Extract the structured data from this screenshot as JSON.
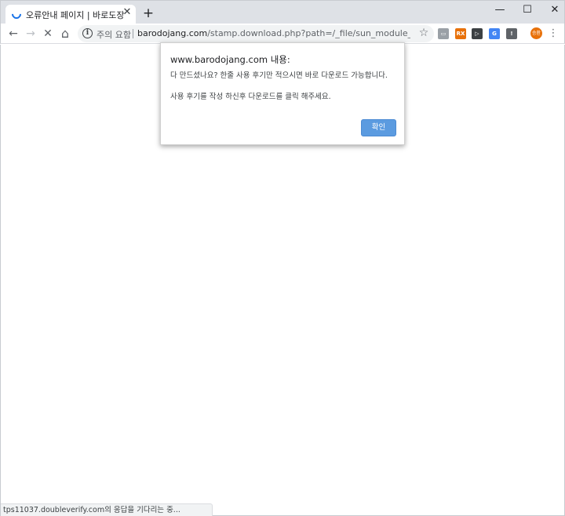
{
  "tab": {
    "title": "오류안내 페이지 | 바로도장",
    "close": "✕",
    "new_tab": "+"
  },
  "window": {
    "minimize": "—",
    "maximize": "☐",
    "close": "✕"
  },
  "toolbar": {
    "back": "←",
    "forward": "→",
    "stop": "✕",
    "home": "⌂",
    "security_label": "주의 요함",
    "url_host": "barodojang.com",
    "url_rest": "/stamp.download.php?path=/_file/sun_module_stamp&imag...",
    "star": "☆",
    "menu": "⋮"
  },
  "extensions": [
    {
      "name": "screen-capture-icon",
      "label": "▭",
      "color": "#9aa0a6"
    },
    {
      "name": "rss-extension-icon",
      "label": "RX",
      "color": "#e8710a"
    },
    {
      "name": "tag-extension-icon",
      "label": "▷",
      "color": "#3c4043"
    },
    {
      "name": "translate-icon",
      "label": "G",
      "color": "#4285f4"
    },
    {
      "name": "alert-extension-icon",
      "label": "!",
      "color": "#5f6368"
    }
  ],
  "profile": {
    "initials": "승환"
  },
  "dialog": {
    "title": "www.barodojang.com 내용:",
    "line1": "다 만드셨나요? 한줄 사용 후기만 적으시면 바로 다운로드 가능합니다.",
    "line2": "사용 후기를 작성 하신후 다운로드를 클릭 해주세요.",
    "ok_label": "확인",
    "ok_color": "#5b9be0"
  },
  "status_bar": {
    "text": "tps11037.doubleverify.com의 응답을 기다리는 중..."
  }
}
